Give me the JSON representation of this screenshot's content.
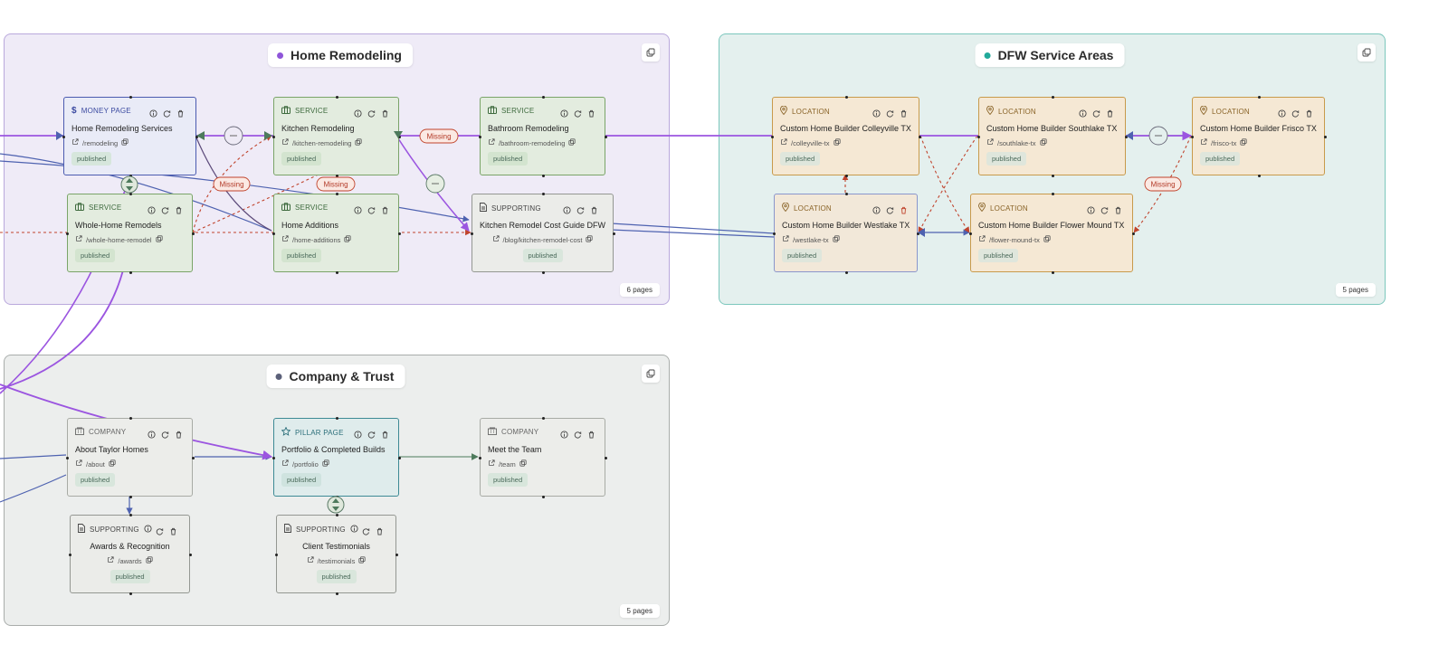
{
  "groups": {
    "remodel": {
      "title": "Home Remodeling",
      "count": "6 pages",
      "dot_color": "#8f55d9"
    },
    "dfw": {
      "title": "DFW Service Areas",
      "count": "5 pages",
      "dot_color": "#21a99a"
    },
    "company": {
      "title": "Company & Trust",
      "count": "5 pages",
      "dot_color": "#5b6079"
    }
  },
  "nodes": {
    "money": {
      "type": "MONEY PAGE",
      "title": "Home Remodeling Services",
      "url": "/remodeling",
      "status": "published"
    },
    "kitchen": {
      "type": "SERVICE",
      "title": "Kitchen Remodeling",
      "url": "/kitchen-remodeling",
      "status": "published"
    },
    "bathroom": {
      "type": "SERVICE",
      "title": "Bathroom Remodeling",
      "url": "/bathroom-remodeling",
      "status": "published"
    },
    "whole": {
      "type": "SERVICE",
      "title": "Whole-Home Remodels",
      "url": "/whole-home-remodel",
      "status": "published"
    },
    "additions": {
      "type": "SERVICE",
      "title": "Home Additions",
      "url": "/home-additions",
      "status": "published"
    },
    "guide": {
      "type": "SUPPORTING",
      "title": "Kitchen Remodel Cost Guide DFW",
      "url": "/blog/kitchen-remodel-cost",
      "status": "published"
    },
    "colleyville": {
      "type": "LOCATION",
      "title": "Custom Home Builder Colleyville TX",
      "url": "/colleyville-tx",
      "status": "published"
    },
    "southlake": {
      "type": "LOCATION",
      "title": "Custom Home Builder Southlake TX",
      "url": "/southlake-tx",
      "status": "published"
    },
    "frisco": {
      "type": "LOCATION",
      "title": "Custom Home Builder Frisco TX",
      "url": "/frisco-tx",
      "status": "published"
    },
    "westlake": {
      "type": "LOCATION",
      "title": "Custom Home Builder Westlake TX",
      "url": "/westlake-tx",
      "status": "published"
    },
    "flowermound": {
      "type": "LOCATION",
      "title": "Custom Home Builder Flower Mound TX",
      "url": "/flower-mound-tx",
      "status": "published"
    },
    "about": {
      "type": "COMPANY",
      "title": "About Taylor Homes",
      "url": "/about",
      "status": "published"
    },
    "portfolio": {
      "type": "PILLAR PAGE",
      "title": "Portfolio & Completed Builds",
      "url": "/portfolio",
      "status": "published"
    },
    "team": {
      "type": "COMPANY",
      "title": "Meet the Team",
      "url": "/team",
      "status": "published"
    },
    "awards": {
      "type": "SUPPORTING",
      "title": "Awards & Recognition",
      "url": "/awards",
      "status": "published"
    },
    "testimonials": {
      "type": "SUPPORTING",
      "title": "Client Testimonials",
      "url": "/testimonials",
      "status": "published"
    }
  },
  "edge_labels": {
    "missing": "Missing"
  },
  "colors": {
    "pillar_link": "#9b55e0",
    "internal_link": "#4e62b0",
    "missing_link": "#c0432c",
    "cluster_link": "#4d7a5c"
  }
}
